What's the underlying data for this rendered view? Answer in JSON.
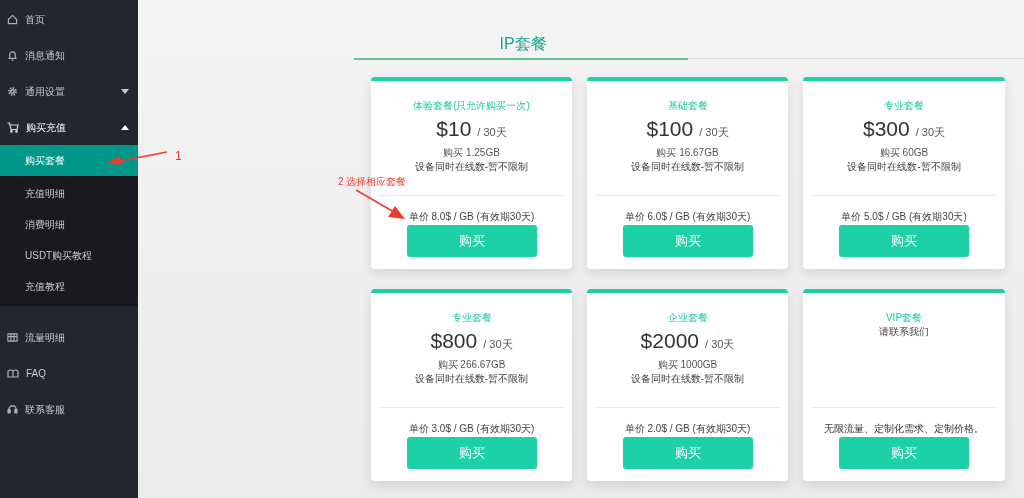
{
  "sidebar": {
    "items": [
      {
        "label": "首页",
        "kind": "link"
      },
      {
        "label": "消息通知",
        "kind": "link"
      },
      {
        "label": "通用设置",
        "kind": "group",
        "expanded": false
      },
      {
        "label": "购买充值",
        "kind": "group",
        "expanded": true,
        "children": [
          {
            "label": "购买套餐",
            "selected": true
          },
          {
            "label": "充值明细",
            "selected": false
          },
          {
            "label": "消费明细",
            "selected": false
          },
          {
            "label": "USDT购买教程",
            "selected": false
          },
          {
            "label": "充值教程",
            "selected": false
          }
        ]
      },
      {
        "label": "流量明细",
        "kind": "link"
      },
      {
        "label": "FAQ",
        "kind": "link"
      },
      {
        "label": "联系客服",
        "kind": "link"
      }
    ]
  },
  "page_title": "IP套餐",
  "plans": [
    {
      "kind": "plan",
      "name": "体验套餐(只允许购买一次)",
      "price": "$10",
      "period": "/ 30天",
      "traffic": "购买 1.25GB",
      "devices": "设备同时在线数-暂不限制",
      "unit_price": "单价 8.0$ / GB (有效期30天)",
      "button": "购买"
    },
    {
      "kind": "plan",
      "name": "基础套餐",
      "price": "$100",
      "period": "/ 30天",
      "traffic": "购买 16.67GB",
      "devices": "设备同时在线数-暂不限制",
      "unit_price": "单价 6.0$ / GB (有效期30天)",
      "button": "购买"
    },
    {
      "kind": "plan",
      "name": "专业套餐",
      "price": "$300",
      "period": "/ 30天",
      "traffic": "购买 60GB",
      "devices": "设备同时在线数-暂不限制",
      "unit_price": "单价 5.0$ / GB (有效期30天)",
      "button": "购买"
    },
    {
      "kind": "plan",
      "name": "专业套餐",
      "price": "$800",
      "period": "/ 30天",
      "traffic": "购买 266.67GB",
      "devices": "设备同时在线数-暂不限制",
      "unit_price": "单价 3.0$ / GB (有效期30天)",
      "button": "购买"
    },
    {
      "kind": "plan",
      "name": "企业套餐",
      "price": "$2000",
      "period": "/ 30天",
      "traffic": "购买 1000GB",
      "devices": "设备同时在线数-暂不限制",
      "unit_price": "单价 2.0$ / GB (有效期30天)",
      "button": "购买"
    },
    {
      "kind": "contact",
      "name": "VIP套餐",
      "note": "请联系我们",
      "description": "无限流量、定制化需求、定制价格。",
      "button": "购买"
    }
  ],
  "annotations": [
    {
      "label": "1"
    },
    {
      "label": "2 选择相应套餐"
    }
  ]
}
